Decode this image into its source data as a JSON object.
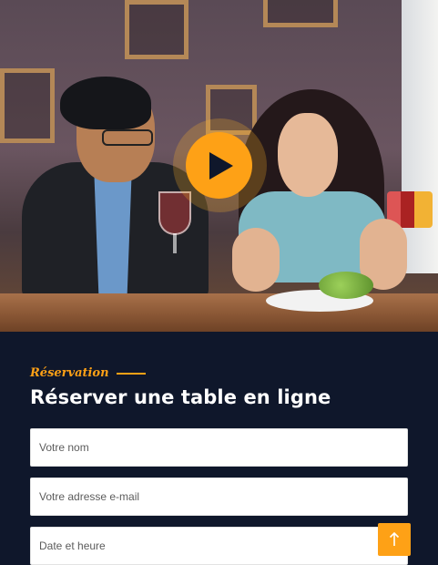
{
  "hero": {
    "play_icon": "play-icon"
  },
  "reservation": {
    "subtitle": "Réservation",
    "title": "Réserver une table en ligne",
    "fields": {
      "name_placeholder": "Votre nom",
      "email_placeholder": "Votre adresse e-mail",
      "datetime_placeholder": "Date et heure"
    }
  },
  "back_to_top": {
    "icon": "arrow-up-icon"
  },
  "colors": {
    "accent": "#fea116",
    "dark": "#0f172b"
  }
}
